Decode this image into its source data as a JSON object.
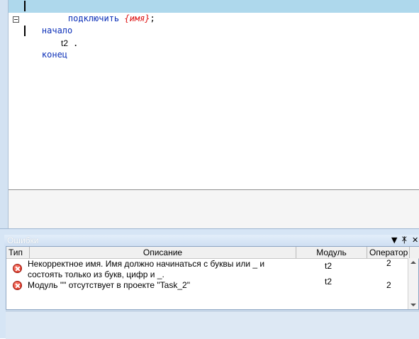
{
  "editor": {
    "line1": {
      "keyword": "подключить",
      "param": "{имя}",
      "punct": ";"
    },
    "line2": {
      "keyword": "начало"
    },
    "line4": {
      "keyword": "конец",
      "name": "t2",
      "punct": "."
    }
  },
  "errors_panel": {
    "title": "Ошибки",
    "controls": {
      "menu": "▼",
      "pin": "ᛡ",
      "close": "✕"
    },
    "columns": [
      "Тип",
      "Описание",
      "Модуль",
      "Оператор"
    ],
    "rows": [
      {
        "type_icon": "error-icon",
        "description_line1": "Некорректное имя. Имя должно начинаться с буквы или _ и",
        "description_line2": "состоять только из букв, цифр и _.",
        "module": "t2",
        "operator": "2"
      },
      {
        "type_icon": "error-icon",
        "description_line1": "Модуль \"\" отсутствует в проекте \"Task_2\"",
        "description_line2": "",
        "module": "t2",
        "operator": "2"
      }
    ]
  },
  "colors": {
    "keyword": "#0b2fb8",
    "param": "#dd1111",
    "highlight": "#aed8ec",
    "panel_bg": "#d6e5f5"
  }
}
